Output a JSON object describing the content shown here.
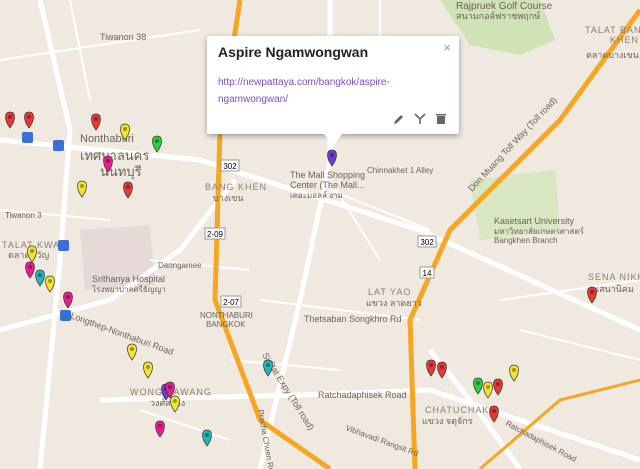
{
  "popup": {
    "title": "Aspire Ngamwongwan",
    "link": "http://newpattaya.com/bangkok/aspire-ngamwongwan/",
    "close_glyph": "×",
    "tools": [
      "pencil-icon",
      "style-icon",
      "trash-icon"
    ]
  },
  "labels": {
    "golf": "Rajpruek Golf Course",
    "golf_th": "สนามกอล์ฟราชพฤกษ์",
    "talat_bang_khen": "TALAT BANG",
    "talat_bang_khen2": "KHEN",
    "talat_th": "ตลาดบางเขน",
    "tiwanon38": "Tiwanon 38",
    "nonthaburi_th": "เทศบาลนคร",
    "nonthaburi_th2": "นนทบุรี",
    "nonthaburi": "Nonthaburi",
    "mall1": "The Mall Shopping",
    "mall2": "Center (The Mall...",
    "mall3": "เดอะมอลล์ งาม",
    "chinnakhet": "Chinnakhet 1 Alley",
    "bang_khen": "BANG KHEN",
    "bang_khen_th": "บางเขน",
    "don_muang": "Don Muang Toll Way (Toll road)",
    "kasetsart1": "Kasetsart University",
    "kasetsart2": "มหาวิทยาลัยเกษตรศาสตร์",
    "kasetsart3": "Bangkhen Branch",
    "tiwanon3": "Tiwanon 3",
    "talat_kwan": "TALAT KWAN",
    "talat_kwan_th": "ตลาดขวัญ",
    "srithanya": "Srithanya Hospital",
    "srithanya_th": "โรงพยาบาลศรีธัญญา",
    "daongamee": "Daongamee",
    "nonthaburi_area": "NONTHABURI",
    "bangkok_area": "BANGKOK",
    "sena_nikhom": "SENA NIKHOM",
    "sena_th": "เสนานิคม",
    "lat_yao": "LAT YAO",
    "lat_yao_th": "แขวง ลาดยาว",
    "thetsaban": "Thetsaban Songkhro Rd",
    "nontha_road": "Longthep-Nonthaburi Road",
    "wong_sawang": "WONG SAWANG",
    "wong_th": "วงศ์สว่าง",
    "ratchadaphisek": "Ratchadaphisek Road",
    "si_rat": "Si Rat Expy (Toll road)",
    "chatuchak": "CHATUCHAK",
    "chatuchak_th": "แขวง จตุจักร",
    "prachachuen": "Pracha Chuen Road",
    "vibhavadi": "Vibhavadi Rangsit Rd",
    "ratchadaphisek2": "Ratchadaphisek Road",
    "shield_302a": "302",
    "shield_302b": "302",
    "shield_209": "2-09",
    "shield_207": "2-07",
    "shield_14": "14"
  },
  "colors": {
    "pin_red": "#e53935",
    "pin_pink": "#e91e8c",
    "pin_yellow": "#f2e234",
    "pin_green": "#2ecc40",
    "pin_teal": "#26b5b5",
    "pin_purple": "#6a3fd0",
    "tollway": "#f5a623",
    "road": "#ffffff"
  }
}
